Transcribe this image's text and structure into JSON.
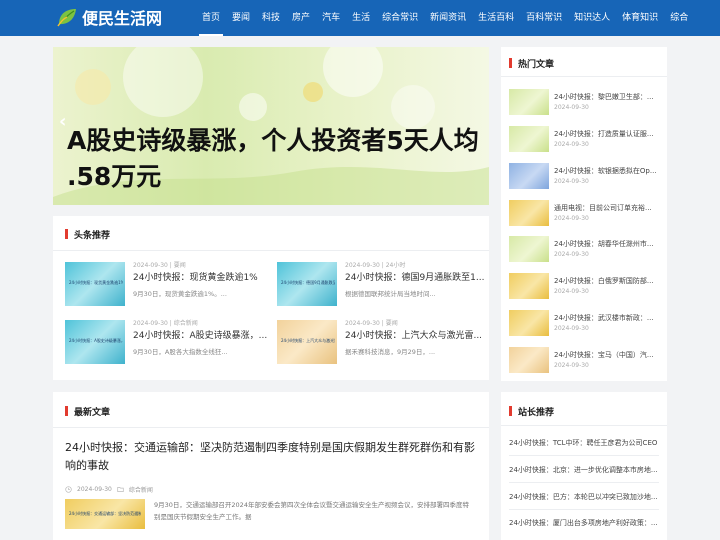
{
  "site": {
    "name": "便民生活网"
  },
  "nav": [
    "首页",
    "要闻",
    "科技",
    "房产",
    "汽车",
    "生活",
    "综合常识",
    "新闻资讯",
    "生活百科",
    "百科常识",
    "知识达人",
    "体育知识",
    "综合"
  ],
  "slider": {
    "headline_line1": "A股史诗级暴涨，个人投资者5天人均",
    "headline_line2": ".58万元"
  },
  "headline_section": {
    "title": "头条推荐",
    "items": [
      {
        "date": "2024-09-30",
        "category": "要闻",
        "title": "24小时快报：现货黄金跌逾1%",
        "desc": "9月30日，现货黄金跌逾1%。..."
      },
      {
        "date": "2024-09-30",
        "category": "24小时",
        "title": "24小时快报：德国9月通胀跌至1...",
        "desc": "根据德国联邦统计局当地时间..."
      },
      {
        "date": "2024-09-30",
        "category": "综合新闻",
        "title": "24小时快报：A股史诗级暴涨，...",
        "desc": "9月30日，A股各大指数全线狂..."
      },
      {
        "date": "2024-09-30",
        "category": "要闻",
        "title": "24小时快报：上汽大众与激光雷...",
        "desc": "据禾赛科技消息，9月29日，..."
      }
    ]
  },
  "latest_section": {
    "title": "最新文章",
    "article": {
      "title": "24小时快报：交通运输部：坚决防范遏制四季度特别是国庆假期发生群死群伤和有影响的事故",
      "date": "2024-09-30",
      "category": "综合新闻",
      "desc": "9月30日，交通运输部召开2024年部安委会第四次全体会议暨交通运输安全生产视频会议，安排部署四季度特别是国庆节假期安全生产工作。据"
    }
  },
  "hot_section": {
    "title": "热门文章",
    "items": [
      {
        "title": "24小时快报：黎巴嫩卫生部：...",
        "date": "2024-09-30"
      },
      {
        "title": "24小时快报：打造质量认证服...",
        "date": "2024-09-30"
      },
      {
        "title": "24小时快报：软银据悉拟在Op...",
        "date": "2024-09-30"
      },
      {
        "title": "通用电视：目前公司订单充裕...",
        "date": "2024-09-30"
      },
      {
        "title": "24小时快报：胡春华任滁州市...",
        "date": "2024-09-30"
      },
      {
        "title": "24小时快报：白俄罗斯国防部...",
        "date": "2024-09-30"
      },
      {
        "title": "24小时快报：武汉楼市新政：...",
        "date": "2024-09-30"
      },
      {
        "title": "24小时快报：宝马（中国）汽...",
        "date": "2024-09-30"
      }
    ]
  },
  "station_section": {
    "title": "站长推荐",
    "items": [
      "24小时快报：TCL中环：聘任王彦君为公司CEO",
      "24小时快报：北京：进一步优化调整本市房地...",
      "24小时快报：巴方：本轮巴以冲突已致加沙地...",
      "24小时快报：厦门出台多项房地产利好政策：..."
    ]
  },
  "colors": {
    "header": "#1765b7",
    "accent": "#e23b2f"
  }
}
